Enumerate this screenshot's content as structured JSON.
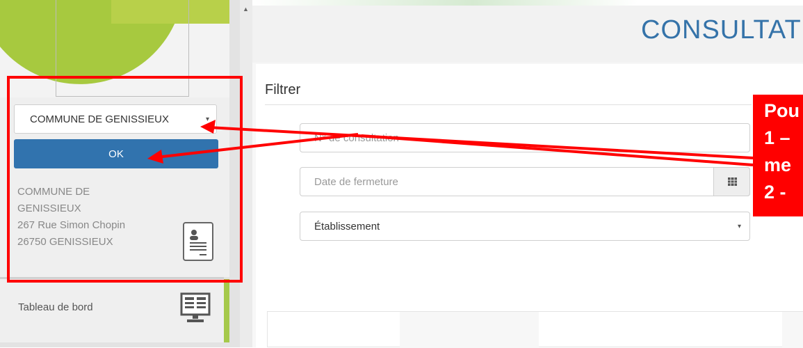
{
  "header": {
    "title": "CONSULTATI"
  },
  "sidebar": {
    "commune_select": {
      "value": "COMMUNE DE GENISSIEUX",
      "caret": "▾"
    },
    "ok_label": "OK",
    "address": {
      "line1": "COMMUNE DE",
      "line2": "GENISSIEUX",
      "line3": "267 Rue Simon Chopin",
      "line4": "26750 GENISSIEUX"
    },
    "nav": [
      {
        "label": "Tableau de bord",
        "icon": "dashboard-icon"
      }
    ]
  },
  "filter": {
    "heading": "Filtrer",
    "consultation_placeholder": "N° de consultation",
    "closing_date_placeholder": "Date de fermeture",
    "establishment": {
      "value": "Établissement",
      "caret": "▾"
    }
  },
  "annotation": {
    "lines": [
      "Pou",
      "1 –",
      "me",
      "2 -"
    ],
    "color": "#ff0000"
  },
  "colors": {
    "accent": "#3173ae",
    "title": "#3573a9",
    "brand_green": "#a7c93f"
  },
  "icons": [
    "logo-leaf-icon",
    "contact-card-icon",
    "dashboard-icon",
    "calendar-icon",
    "scroll-up-icon"
  ]
}
